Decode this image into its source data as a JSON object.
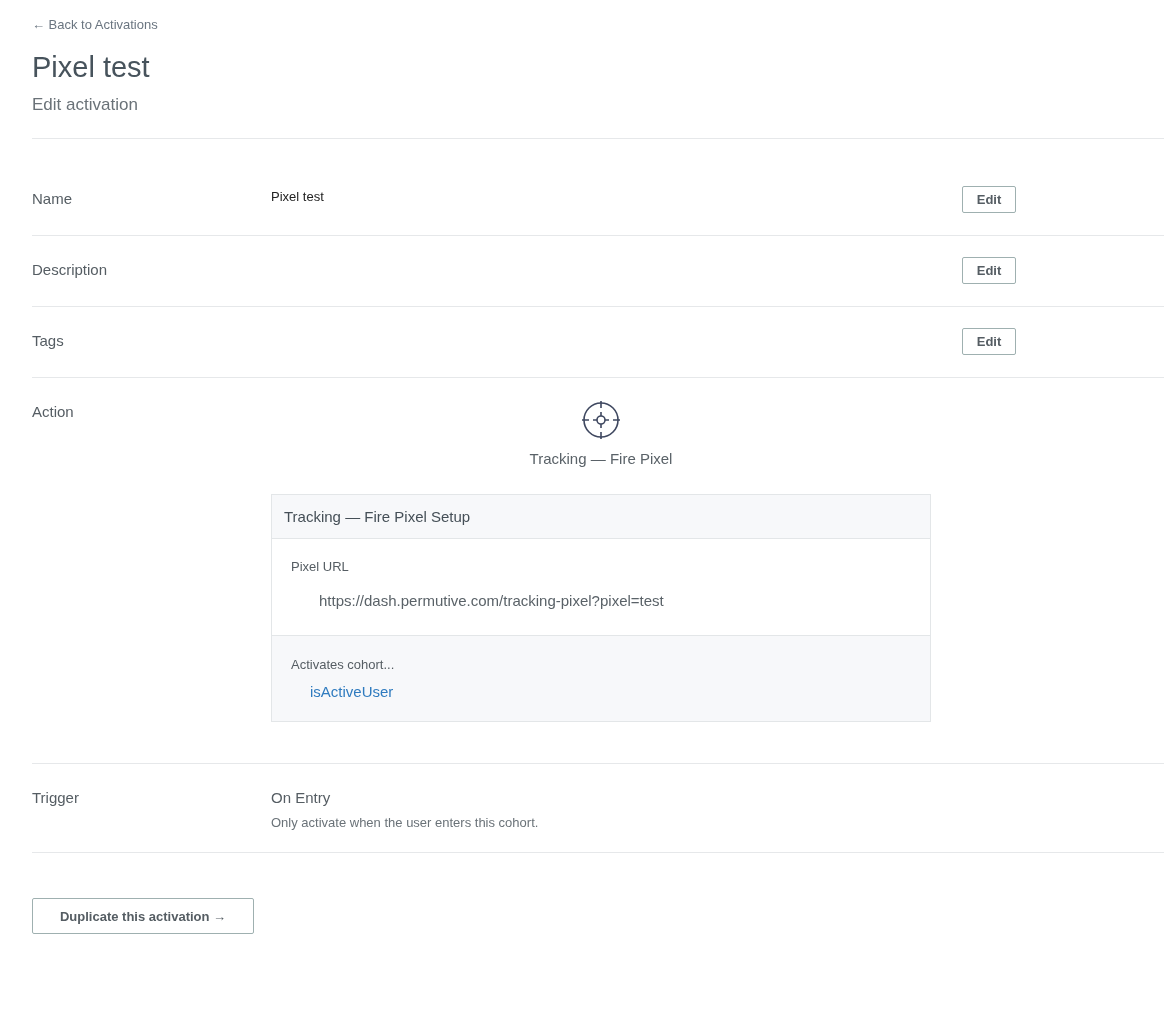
{
  "back_link": "← Back to Activations",
  "title": "Pixel test",
  "subtitle": "Edit activation",
  "rows": [
    {
      "kind": "text",
      "label": "Name",
      "value": "Pixel test",
      "button": "Edit"
    },
    {
      "kind": "text",
      "label": "Description",
      "button": "Edit"
    },
    {
      "kind": "text",
      "label": "Tags",
      "button": "Edit"
    },
    {
      "kind": "action",
      "label": "Action",
      "action_name": "Tracking — Fire Pixel",
      "setup": {
        "title": "Tracking — Fire Pixel Setup",
        "field_label": "Pixel URL",
        "field_value": "https://dash.permutive.com/tracking-pixel?pixel=test",
        "cohort_label": "Activates cohort...",
        "cohort": "isActiveUser"
      }
    },
    {
      "kind": "trigger",
      "label": "Trigger",
      "value": "On Entry",
      "description": "Only activate when the user enters this cohort."
    }
  ],
  "duplicate_button": "Duplicate this activation →"
}
